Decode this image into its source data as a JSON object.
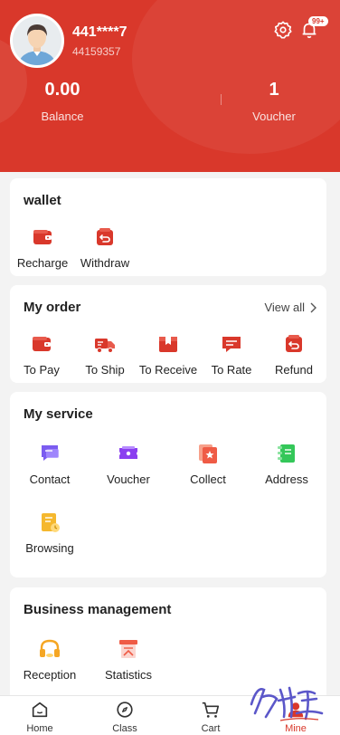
{
  "header": {
    "username": "441****7",
    "user_id": "44159357",
    "notification_badge": "99+",
    "accent_color": "#d9382b",
    "settings_icon": "gear-icon",
    "notification_icon": "bell-icon"
  },
  "stats": [
    {
      "value": "0.00",
      "label": "Balance"
    },
    {
      "value": "1",
      "label": "Voucher"
    }
  ],
  "wallet": {
    "title": "wallet",
    "items": [
      {
        "label": "Recharge",
        "icon": "wallet-icon"
      },
      {
        "label": "Withdraw",
        "icon": "withdraw-icon"
      }
    ]
  },
  "orders": {
    "title": "My order",
    "view_all": "View all",
    "items": [
      {
        "label": "To Pay",
        "icon": "wallet-icon"
      },
      {
        "label": "To Ship",
        "icon": "truck-icon"
      },
      {
        "label": "To Receive",
        "icon": "box-icon"
      },
      {
        "label": "To Rate",
        "icon": "rate-icon"
      },
      {
        "label": "Refund",
        "icon": "refund-icon"
      }
    ]
  },
  "service": {
    "title": "My service",
    "items": [
      {
        "label": "Contact",
        "icon": "chat-icon"
      },
      {
        "label": "Voucher",
        "icon": "ticket-icon"
      },
      {
        "label": "Collect",
        "icon": "star-icon"
      },
      {
        "label": "Address",
        "icon": "address-book-icon"
      },
      {
        "label": "Browsing",
        "icon": "history-icon"
      }
    ]
  },
  "business": {
    "title": "Business management",
    "items": [
      {
        "label": "Reception",
        "icon": "headset-icon"
      },
      {
        "label": "Statistics",
        "icon": "statistics-icon"
      }
    ]
  },
  "tabbar": [
    {
      "label": "Home",
      "icon": "home-icon"
    },
    {
      "label": "Class",
      "icon": "compass-icon"
    },
    {
      "label": "Cart",
      "icon": "cart-icon"
    },
    {
      "label": "Mine",
      "icon": "user-icon",
      "active": true
    }
  ]
}
